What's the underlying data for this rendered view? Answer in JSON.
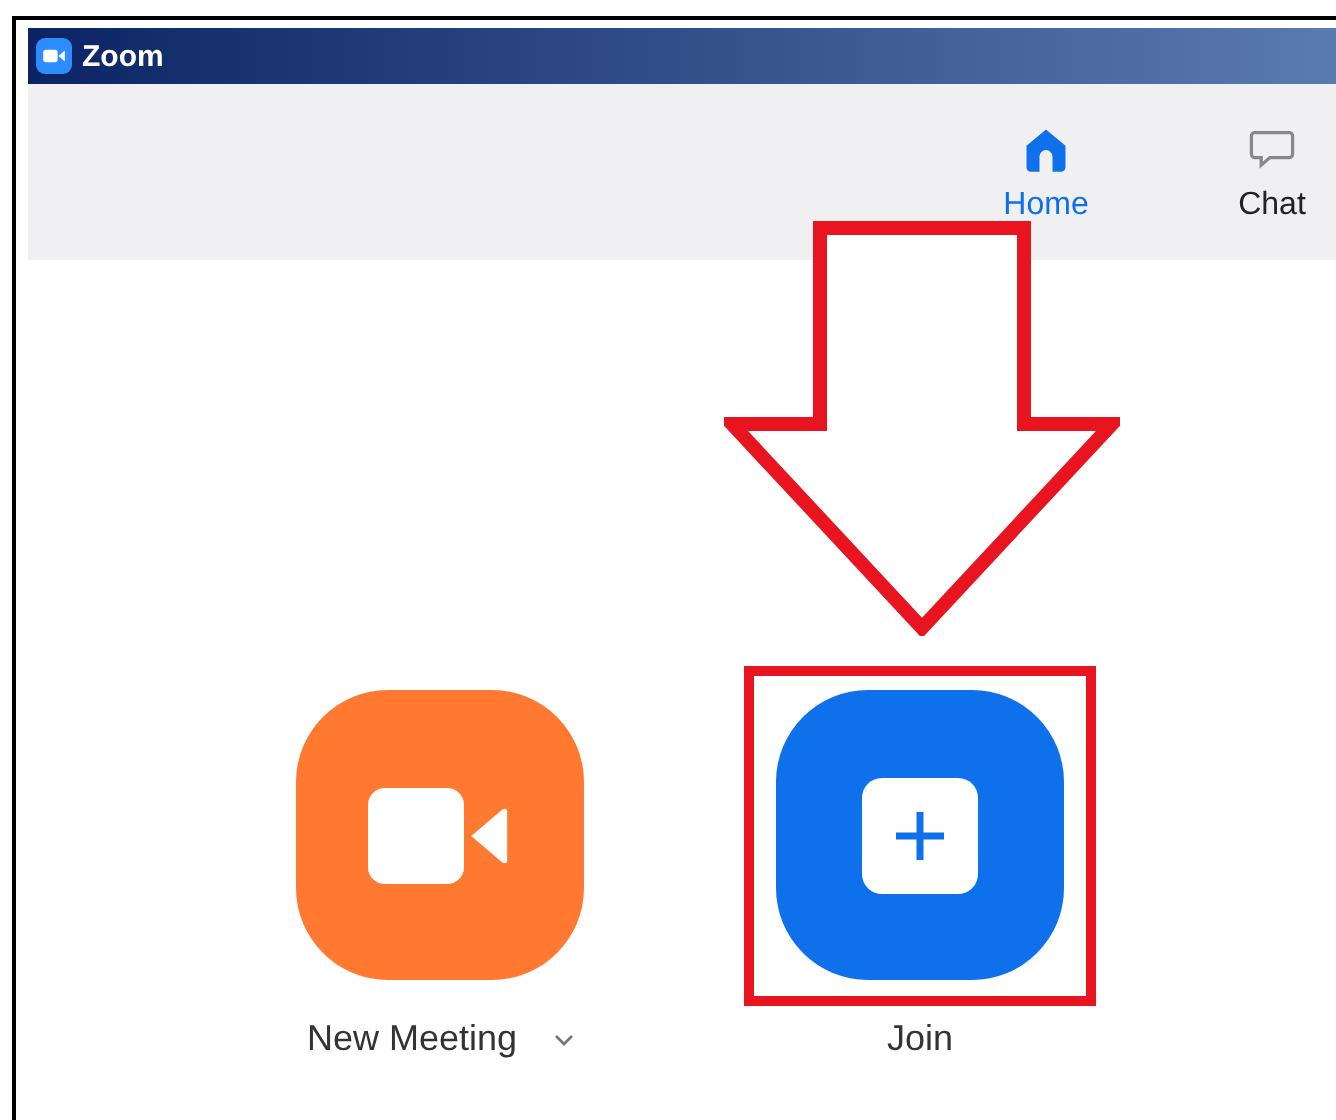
{
  "window": {
    "title": "Zoom"
  },
  "tabs": [
    {
      "label": "Home",
      "kind": "home",
      "selected": true
    },
    {
      "label": "Chat",
      "kind": "chat",
      "selected": false
    }
  ],
  "actions": [
    {
      "label": "New Meeting",
      "kind": "new-meeting",
      "has_dropdown": true,
      "highlighted": false
    },
    {
      "label": "Join",
      "kind": "join",
      "has_dropdown": false,
      "highlighted": true
    }
  ]
}
